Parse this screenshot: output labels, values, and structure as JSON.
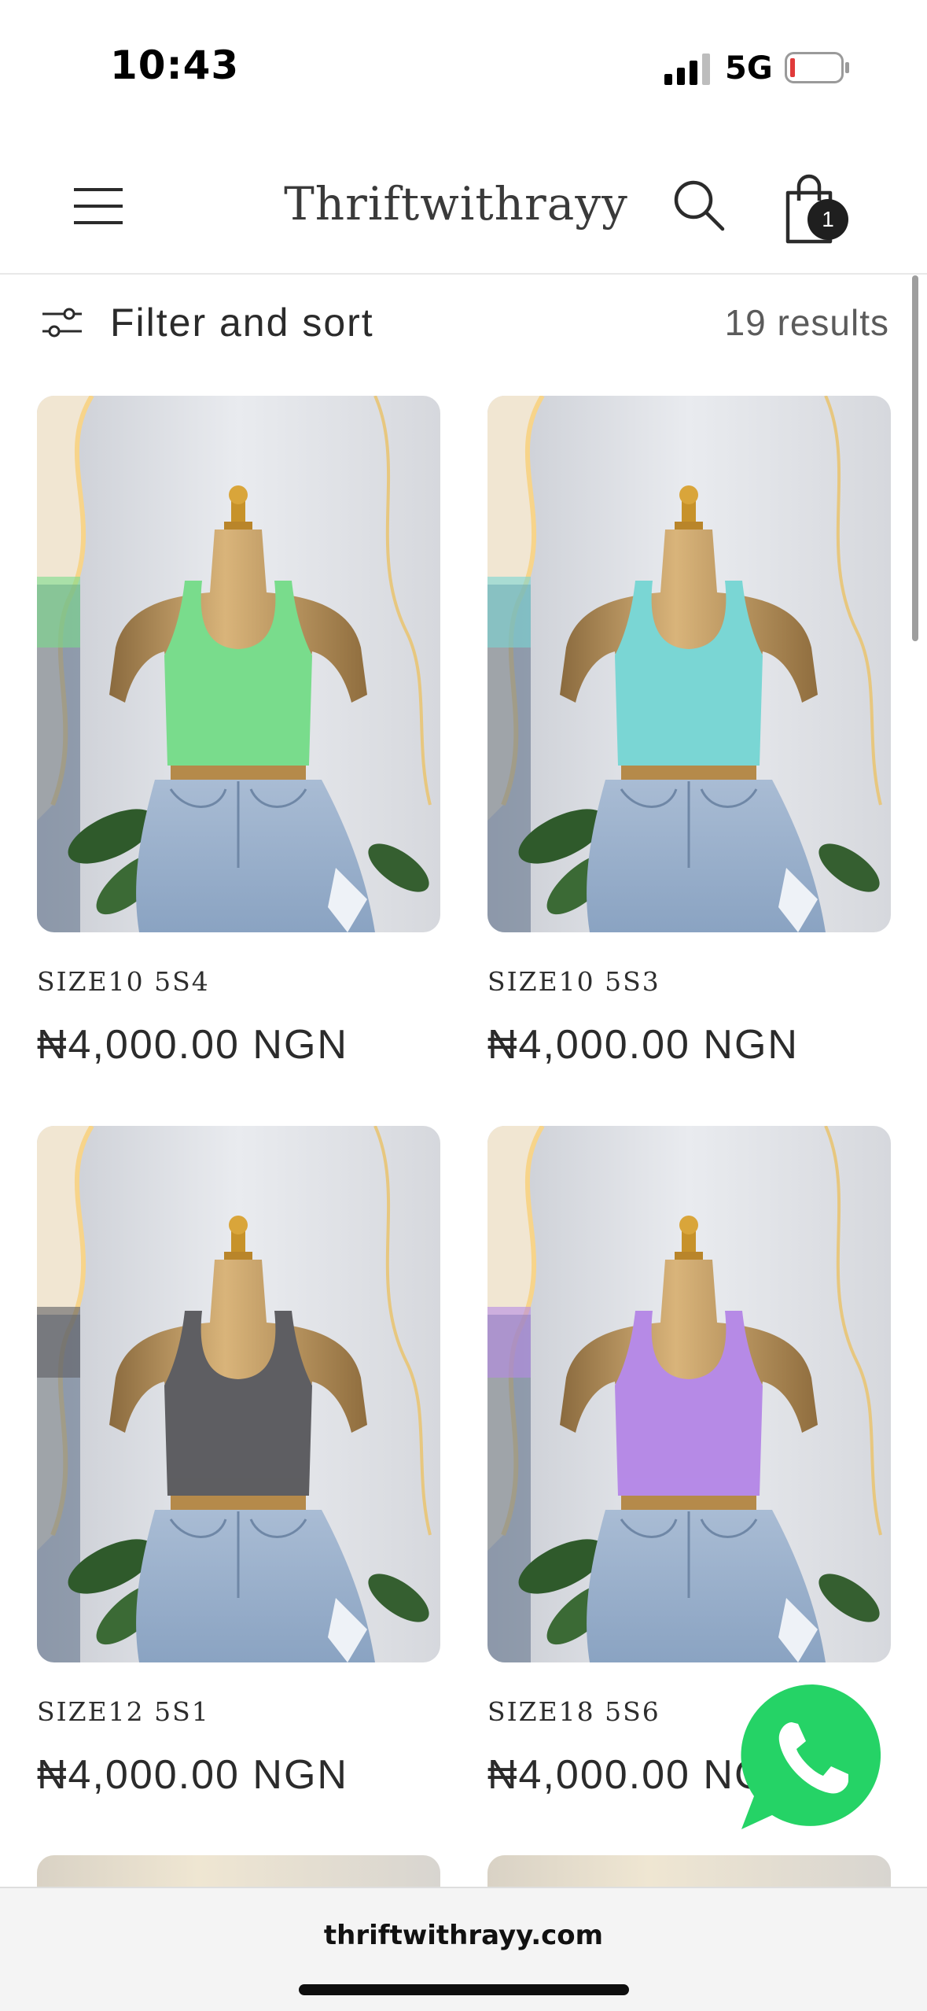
{
  "status_bar": {
    "time": "10:43",
    "network": "5G",
    "battery_color": "#e03a3a"
  },
  "header": {
    "brand": "Thriftwithrayy",
    "cart_count": "1",
    "icons": [
      "menu-icon",
      "search-icon",
      "cart-bag-icon"
    ]
  },
  "filter": {
    "label": "Filter and sort",
    "results": "19 results"
  },
  "products": [
    {
      "title": "SIZE10 5S4",
      "price": "₦4,000.00 NGN",
      "top_color": "#79dc8c"
    },
    {
      "title": "SIZE10 5S3",
      "price": "₦4,000.00 NGN",
      "top_color": "#7ad6d4"
    },
    {
      "title": "SIZE12 5S1",
      "price": "₦4,000.00 NGN",
      "top_color": "#5e5e62"
    },
    {
      "title": "SIZE18 5S6",
      "price": "₦4,000.00 NGN",
      "top_color": "#b68ae6"
    }
  ],
  "whatsapp": {
    "color": "#25d366",
    "icon": "whatsapp-icon"
  },
  "browser": {
    "url": "thriftwithrayy.com"
  }
}
